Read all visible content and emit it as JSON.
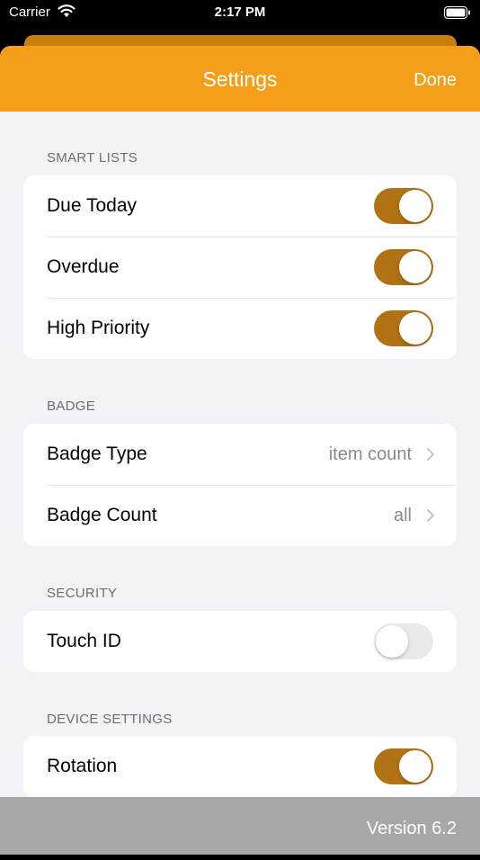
{
  "status_bar": {
    "carrier": "Carrier",
    "time": "2:17 PM"
  },
  "nav": {
    "title": "Settings",
    "done_label": "Done"
  },
  "sections": {
    "smart_lists": {
      "header": "SMART LISTS",
      "rows": [
        {
          "label": "Due Today",
          "on": true
        },
        {
          "label": "Overdue",
          "on": true
        },
        {
          "label": "High Priority",
          "on": true
        }
      ]
    },
    "badge": {
      "header": "BADGE",
      "rows": [
        {
          "label": "Badge Type",
          "value": "item count"
        },
        {
          "label": "Badge Count",
          "value": "all"
        }
      ]
    },
    "security": {
      "header": "SECURITY",
      "rows": [
        {
          "label": "Touch ID",
          "on": false
        }
      ]
    },
    "device_settings": {
      "header": "DEVICE SETTINGS",
      "rows": [
        {
          "label": "Rotation",
          "on": true
        }
      ]
    }
  },
  "footer": {
    "version": "Version 6.2"
  },
  "colors": {
    "accent": "#f49e1a",
    "toggle_on": "#b07212",
    "toggle_off": "#e9e9eb",
    "background": "#f2f2f7"
  }
}
